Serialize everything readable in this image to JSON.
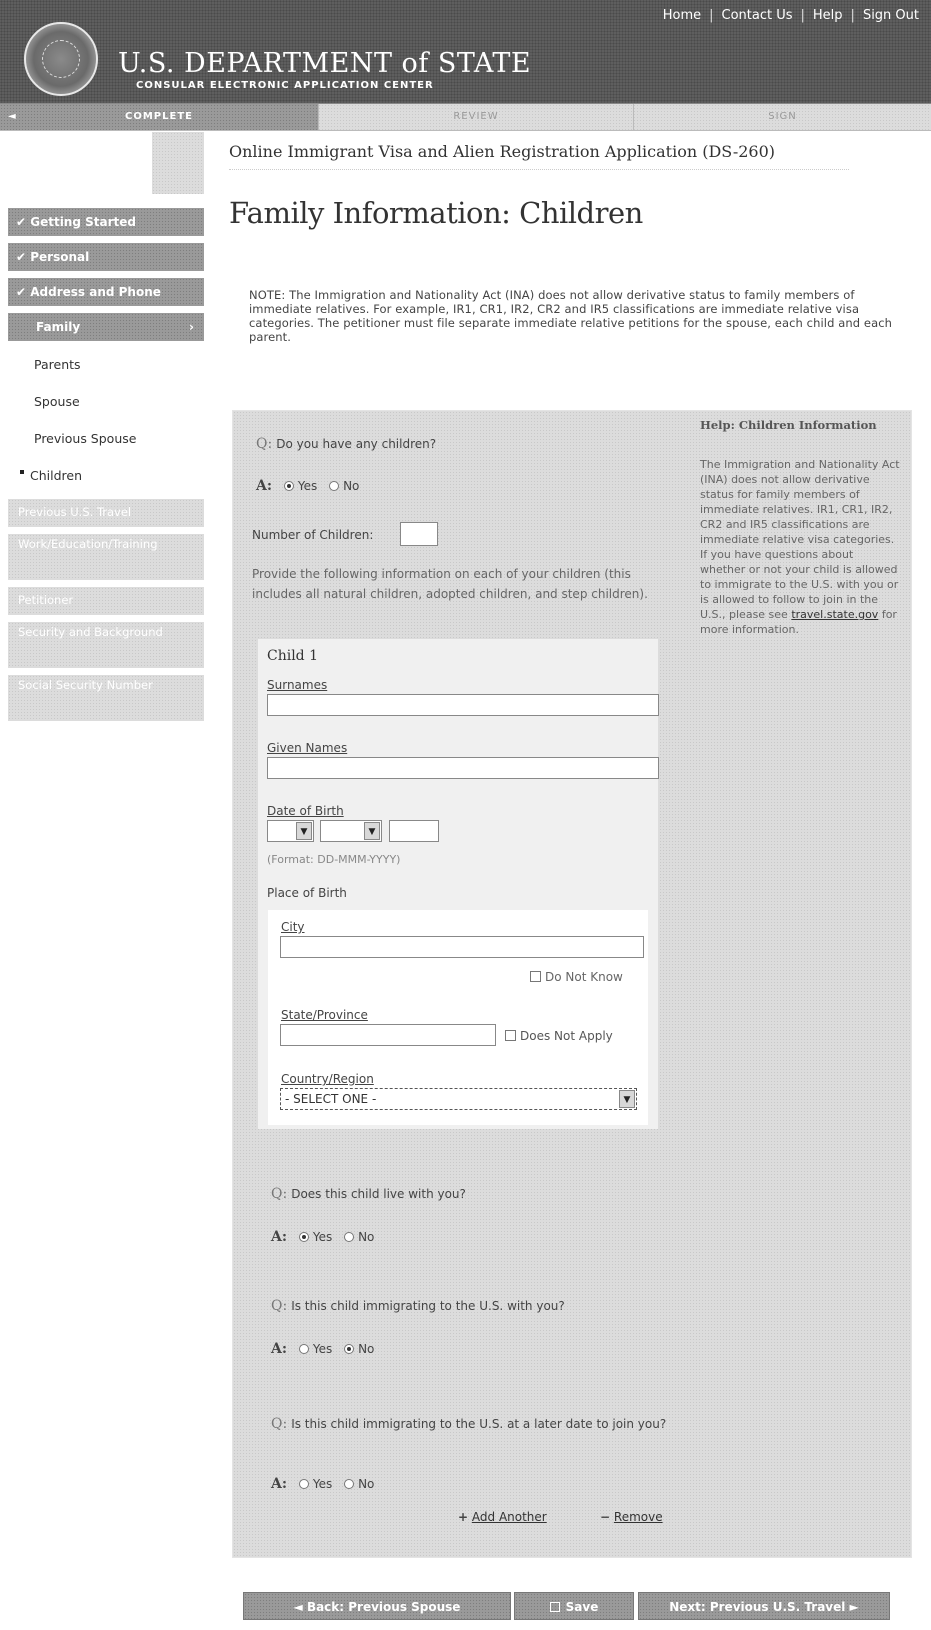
{
  "header": {
    "top_links": [
      "Home",
      "Contact Us",
      "Help",
      "Sign Out"
    ],
    "dept_title": "U.S. DEPARTMENT of STATE",
    "dept_subtitle": "CONSULAR ELECTRONIC APPLICATION CENTER"
  },
  "progress": {
    "steps": [
      "COMPLETE",
      "REVIEW",
      "SIGN"
    ]
  },
  "app_title": "Online Immigrant Visa and Alien Registration Application (DS-260)",
  "page_title": "Family Information: Children",
  "note": "NOTE: The Immigration and Nationality Act (INA) does not allow derivative status to family members of immediate relatives. For example, IR1, CR1, IR2, CR2 and IR5 classifications are immediate relative visa categories. The petitioner must file separate immediate relative petitions for the spouse, each child and each parent.",
  "sidebar": {
    "done": [
      "Getting Started",
      "Personal",
      "Address and Phone"
    ],
    "active": "Family",
    "sub": [
      "Parents",
      "Spouse",
      "Previous Spouse",
      "Children"
    ],
    "pending": [
      "Previous U.S. Travel",
      "Work/Education/Training",
      "Petitioner",
      "Security and Background",
      "Social Security Number"
    ]
  },
  "form": {
    "q1": "Do you have any children?",
    "q_mark": "Q:",
    "a_mark": "A:",
    "yes": "Yes",
    "no": "No",
    "num_children_label": "Number of Children:",
    "num_children_value": "",
    "provide_text": "Provide the following information on each of your children (this includes all natural children, adopted children, and step children).",
    "child_title": "Child 1",
    "surnames_label": "Surnames",
    "given_names_label": "Given Names",
    "dob_label": "Date of Birth",
    "dob_format": "(Format: DD-MMM-YYYY)",
    "pob_label": "Place of Birth",
    "city_label": "City",
    "do_not_know": "Do Not Know",
    "state_label": "State/Province",
    "does_not_apply": "Does Not Apply",
    "country_label": "Country/Region",
    "country_value": "- SELECT ONE -",
    "q2": "Does this child live with you?",
    "q3": "Is this child immigrating to the U.S. with you?",
    "q4": "Is this child immigrating to the U.S. at a later date to join you?",
    "add_another": "Add Another",
    "remove": "Remove"
  },
  "help": {
    "title": "Help: Children Information",
    "body": "The Immigration and Nationality Act (INA) does not allow derivative status for family members of immediate relatives. IR1, CR1, IR2, CR2 and IR5 classifications are immediate relative visa categories. If you have questions about whether or not your child is allowed to immigrate to the U.S. with you or is allowed to follow to join in the U.S., please see",
    "link": "travel.state.gov",
    "tail": "for more information."
  },
  "buttons": {
    "back": "◄ Back: Previous Spouse",
    "save": "Save",
    "next": "Next: Previous U.S. Travel ►"
  }
}
